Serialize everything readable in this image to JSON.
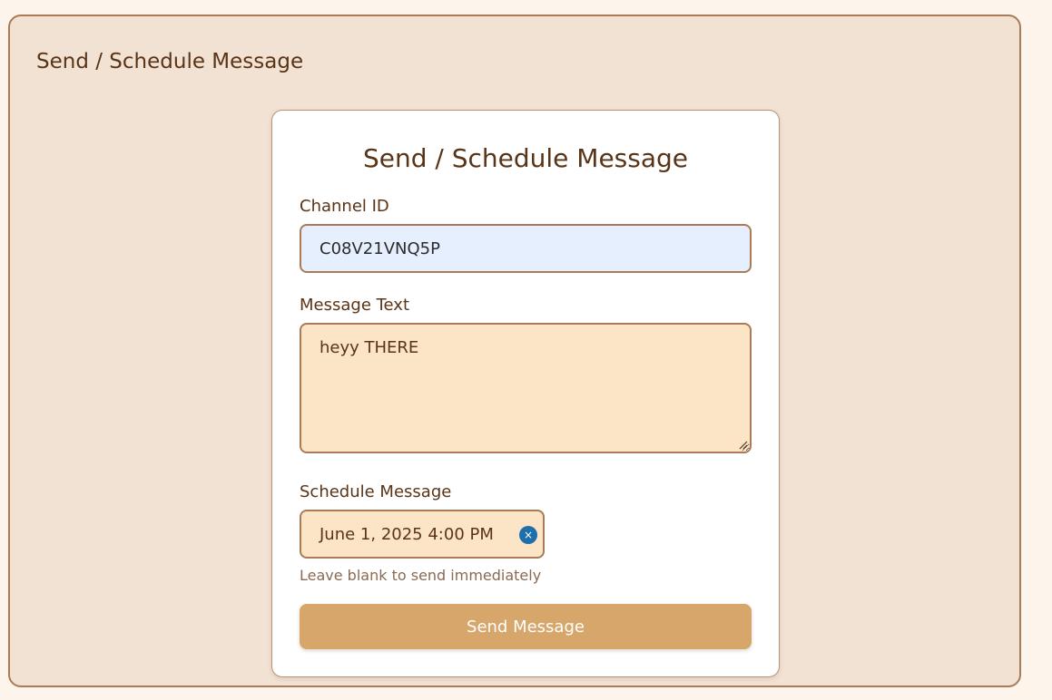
{
  "panel": {
    "heading": "Send / Schedule Message"
  },
  "form": {
    "title": "Send / Schedule Message",
    "channel": {
      "label": "Channel ID",
      "value": "C08V21VNQ5P"
    },
    "message": {
      "label": "Message Text",
      "value": "heyy THERE"
    },
    "schedule": {
      "label": "Schedule Message",
      "value": "June 1, 2025 4:00 PM",
      "clear_icon": "×",
      "hint": "Leave blank to send immediately"
    },
    "submit_label": "Send Message"
  },
  "icons": {
    "clear": "close-icon",
    "resize": "resize-grip-icon"
  },
  "colors": {
    "page_bg": "#fdf5ec",
    "panel_bg": "#f2e2d4",
    "border": "#a97b57",
    "text": "#5a3416",
    "channel_input_bg": "#e6effd",
    "warm_input_bg": "#fce5c6",
    "button_bg": "#d6a66b",
    "clear_icon_bg": "#1f6fad"
  }
}
